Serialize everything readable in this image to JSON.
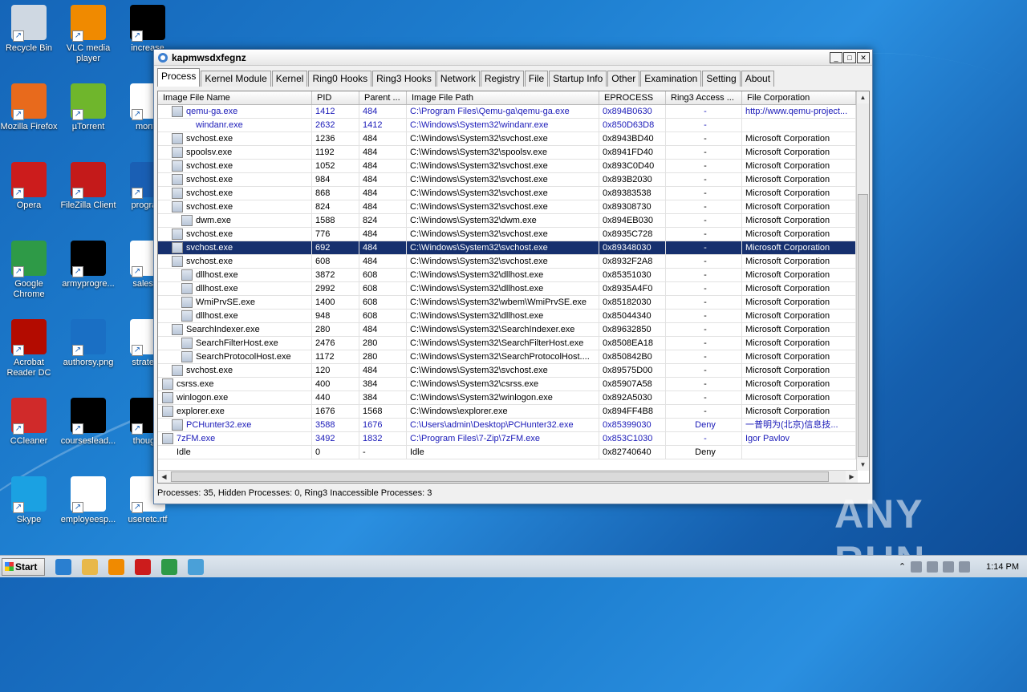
{
  "desktop": {
    "icons": [
      {
        "name": "recycle-bin",
        "label": "Recycle Bin",
        "color": "#cfd8e2"
      },
      {
        "name": "vlc",
        "label": "VLC media player",
        "color": "#f08a00"
      },
      {
        "name": "increase",
        "label": "increase",
        "color": "#000000"
      },
      {
        "name": "firefox",
        "label": "Mozilla Firefox",
        "color": "#e86a1c"
      },
      {
        "name": "utorrent",
        "label": "µTorrent",
        "color": "#6fb62c"
      },
      {
        "name": "monty",
        "label": "monty",
        "color": "#ffffff"
      },
      {
        "name": "opera",
        "label": "Opera",
        "color": "#cc1c1c"
      },
      {
        "name": "filezilla",
        "label": "FileZilla Client",
        "color": "#c41a1a"
      },
      {
        "name": "program",
        "label": "program",
        "color": "#1a5fb4"
      },
      {
        "name": "chrome",
        "label": "Google Chrome",
        "color": "#2e9a47"
      },
      {
        "name": "armyprogre",
        "label": "armyprogre...",
        "color": "#000000"
      },
      {
        "name": "salesco",
        "label": "salesco",
        "color": "#ffffff"
      },
      {
        "name": "acrobat",
        "label": "Acrobat Reader DC",
        "color": "#b30b00"
      },
      {
        "name": "authorsy",
        "label": "authorsy.png",
        "color": "#1a6fc4"
      },
      {
        "name": "strategy",
        "label": "strategy",
        "color": "#ffffff"
      },
      {
        "name": "ccleaner",
        "label": "CCleaner",
        "color": "#d02a2a"
      },
      {
        "name": "courseslead",
        "label": "courseslead...",
        "color": "#000000"
      },
      {
        "name": "thought",
        "label": "thought",
        "color": "#000000"
      },
      {
        "name": "skype",
        "label": "Skype",
        "color": "#1ba1e2"
      },
      {
        "name": "employeesp",
        "label": "employeesp...",
        "color": "#ffffff"
      },
      {
        "name": "useretc",
        "label": "useretc.rtf",
        "color": "#ffffff"
      }
    ]
  },
  "window": {
    "title": "kapmwsdxfegnz",
    "tabs": [
      "Process",
      "Kernel Module",
      "Kernel",
      "Ring0 Hooks",
      "Ring3 Hooks",
      "Network",
      "Registry",
      "File",
      "Startup Info",
      "Other",
      "Examination",
      "Setting",
      "About"
    ],
    "active_tab": "Process",
    "columns": [
      "Image File Name",
      "PID",
      "Parent ...",
      "Image File Path",
      "EPROCESS",
      "Ring3 Access ...",
      "File Corporation"
    ],
    "rows": [
      {
        "name": "qemu-ga.exe",
        "indent": 1,
        "pid": "1412",
        "ppid": "484",
        "path": "C:\\Program Files\\Qemu-ga\\qemu-ga.exe",
        "eprocess": "0x894B0630",
        "ring3": "-",
        "corp": "http://www.qemu-project...",
        "style": "blue",
        "icon": "qemu-icon"
      },
      {
        "name": "windanr.exe",
        "indent": 2,
        "pid": "2632",
        "ppid": "1412",
        "path": "C:\\Windows\\System32\\windanr.exe",
        "eprocess": "0x850D63D8",
        "ring3": "-",
        "corp": "",
        "style": "blue",
        "icon": "none"
      },
      {
        "name": "svchost.exe",
        "indent": 1,
        "pid": "1236",
        "ppid": "484",
        "path": "C:\\Windows\\System32\\svchost.exe",
        "eprocess": "0x8943BD40",
        "ring3": "-",
        "corp": "Microsoft Corporation",
        "style": "normal",
        "icon": "app-icon"
      },
      {
        "name": "spoolsv.exe",
        "indent": 1,
        "pid": "1192",
        "ppid": "484",
        "path": "C:\\Windows\\System32\\spoolsv.exe",
        "eprocess": "0x8941FD40",
        "ring3": "-",
        "corp": "Microsoft Corporation",
        "style": "normal",
        "icon": "app-icon"
      },
      {
        "name": "svchost.exe",
        "indent": 1,
        "pid": "1052",
        "ppid": "484",
        "path": "C:\\Windows\\System32\\svchost.exe",
        "eprocess": "0x893C0D40",
        "ring3": "-",
        "corp": "Microsoft Corporation",
        "style": "normal",
        "icon": "app-icon"
      },
      {
        "name": "svchost.exe",
        "indent": 1,
        "pid": "984",
        "ppid": "484",
        "path": "C:\\Windows\\System32\\svchost.exe",
        "eprocess": "0x893B2030",
        "ring3": "-",
        "corp": "Microsoft Corporation",
        "style": "normal",
        "icon": "app-icon"
      },
      {
        "name": "svchost.exe",
        "indent": 1,
        "pid": "868",
        "ppid": "484",
        "path": "C:\\Windows\\System32\\svchost.exe",
        "eprocess": "0x89383538",
        "ring3": "-",
        "corp": "Microsoft Corporation",
        "style": "normal",
        "icon": "app-icon"
      },
      {
        "name": "svchost.exe",
        "indent": 1,
        "pid": "824",
        "ppid": "484",
        "path": "C:\\Windows\\System32\\svchost.exe",
        "eprocess": "0x89308730",
        "ring3": "-",
        "corp": "Microsoft Corporation",
        "style": "normal",
        "icon": "app-icon"
      },
      {
        "name": "dwm.exe",
        "indent": 2,
        "pid": "1588",
        "ppid": "824",
        "path": "C:\\Windows\\System32\\dwm.exe",
        "eprocess": "0x894EB030",
        "ring3": "-",
        "corp": "Microsoft Corporation",
        "style": "normal",
        "icon": "app-icon"
      },
      {
        "name": "svchost.exe",
        "indent": 1,
        "pid": "776",
        "ppid": "484",
        "path": "C:\\Windows\\System32\\svchost.exe",
        "eprocess": "0x8935C728",
        "ring3": "-",
        "corp": "Microsoft Corporation",
        "style": "normal",
        "icon": "app-icon"
      },
      {
        "name": "svchost.exe",
        "indent": 1,
        "pid": "692",
        "ppid": "484",
        "path": "C:\\Windows\\System32\\svchost.exe",
        "eprocess": "0x89348030",
        "ring3": "-",
        "corp": "Microsoft Corporation",
        "style": "sel",
        "icon": "app-icon"
      },
      {
        "name": "svchost.exe",
        "indent": 1,
        "pid": "608",
        "ppid": "484",
        "path": "C:\\Windows\\System32\\svchost.exe",
        "eprocess": "0x8932F2A8",
        "ring3": "-",
        "corp": "Microsoft Corporation",
        "style": "normal",
        "icon": "app-icon"
      },
      {
        "name": "dllhost.exe",
        "indent": 2,
        "pid": "3872",
        "ppid": "608",
        "path": "C:\\Windows\\System32\\dllhost.exe",
        "eprocess": "0x85351030",
        "ring3": "-",
        "corp": "Microsoft Corporation",
        "style": "normal",
        "icon": "app-icon"
      },
      {
        "name": "dllhost.exe",
        "indent": 2,
        "pid": "2992",
        "ppid": "608",
        "path": "C:\\Windows\\System32\\dllhost.exe",
        "eprocess": "0x8935A4F0",
        "ring3": "-",
        "corp": "Microsoft Corporation",
        "style": "normal",
        "icon": "app-icon"
      },
      {
        "name": "WmiPrvSE.exe",
        "indent": 2,
        "pid": "1400",
        "ppid": "608",
        "path": "C:\\Windows\\System32\\wbem\\WmiPrvSE.exe",
        "eprocess": "0x85182030",
        "ring3": "-",
        "corp": "Microsoft Corporation",
        "style": "normal",
        "icon": "wmi-icon"
      },
      {
        "name": "dllhost.exe",
        "indent": 2,
        "pid": "948",
        "ppid": "608",
        "path": "C:\\Windows\\System32\\dllhost.exe",
        "eprocess": "0x85044340",
        "ring3": "-",
        "corp": "Microsoft Corporation",
        "style": "normal",
        "icon": "app-icon"
      },
      {
        "name": "SearchIndexer.exe",
        "indent": 1,
        "pid": "280",
        "ppid": "484",
        "path": "C:\\Windows\\System32\\SearchIndexer.exe",
        "eprocess": "0x89632850",
        "ring3": "-",
        "corp": "Microsoft Corporation",
        "style": "normal",
        "icon": "app-icon"
      },
      {
        "name": "SearchFilterHost.exe",
        "indent": 2,
        "pid": "2476",
        "ppid": "280",
        "path": "C:\\Windows\\System32\\SearchFilterHost.exe",
        "eprocess": "0x8508EA18",
        "ring3": "-",
        "corp": "Microsoft Corporation",
        "style": "normal",
        "icon": "app-icon"
      },
      {
        "name": "SearchProtocolHost.exe",
        "indent": 2,
        "pid": "1172",
        "ppid": "280",
        "path": "C:\\Windows\\System32\\SearchProtocolHost....",
        "eprocess": "0x850842B0",
        "ring3": "-",
        "corp": "Microsoft Corporation",
        "style": "normal",
        "icon": "app-icon"
      },
      {
        "name": "svchost.exe",
        "indent": 1,
        "pid": "120",
        "ppid": "484",
        "path": "C:\\Windows\\System32\\svchost.exe",
        "eprocess": "0x89575D00",
        "ring3": "-",
        "corp": "Microsoft Corporation",
        "style": "normal",
        "icon": "app-icon"
      },
      {
        "name": "csrss.exe",
        "indent": 0,
        "pid": "400",
        "ppid": "384",
        "path": "C:\\Windows\\System32\\csrss.exe",
        "eprocess": "0x85907A58",
        "ring3": "-",
        "corp": "Microsoft Corporation",
        "style": "normal",
        "icon": "app-icon"
      },
      {
        "name": "winlogon.exe",
        "indent": 0,
        "pid": "440",
        "ppid": "384",
        "path": "C:\\Windows\\System32\\winlogon.exe",
        "eprocess": "0x892A5030",
        "ring3": "-",
        "corp": "Microsoft Corporation",
        "style": "normal",
        "icon": "winlogon-icon"
      },
      {
        "name": "explorer.exe",
        "indent": 0,
        "pid": "1676",
        "ppid": "1568",
        "path": "C:\\Windows\\explorer.exe",
        "eprocess": "0x894FF4B8",
        "ring3": "-",
        "corp": "Microsoft Corporation",
        "style": "normal",
        "icon": "folder-icon"
      },
      {
        "name": "PCHunter32.exe",
        "indent": 1,
        "pid": "3588",
        "ppid": "1676",
        "path": "C:\\Users\\admin\\Desktop\\PCHunter32.exe",
        "eprocess": "0x85399030",
        "ring3": "Deny",
        "corp": "一普明为(北京)信息技...",
        "style": "blue",
        "icon": "pchunter-icon"
      },
      {
        "name": "7zFM.exe",
        "indent": 0,
        "pid": "3492",
        "ppid": "1832",
        "path": "C:\\Program Files\\7-Zip\\7zFM.exe",
        "eprocess": "0x853C1030",
        "ring3": "-",
        "corp": "Igor Pavlov",
        "style": "blue",
        "icon": "7zip-icon"
      },
      {
        "name": "Idle",
        "indent": 0,
        "pid": "0",
        "ppid": "-",
        "path": "Idle",
        "eprocess": "0x82740640",
        "ring3": "Deny",
        "corp": "",
        "style": "normal",
        "icon": "none"
      }
    ],
    "status": "Processes: 35, Hidden Processes: 0, Ring3 Inaccessible Processes: 3"
  },
  "taskbar": {
    "start_label": "Start",
    "apps": [
      {
        "name": "ie-icon",
        "color": "#2a7fd0"
      },
      {
        "name": "explorer-icon",
        "color": "#e8b84a"
      },
      {
        "name": "media-player-icon",
        "color": "#f08a00"
      },
      {
        "name": "opera-icon",
        "color": "#cc1c1c"
      },
      {
        "name": "chrome-icon",
        "color": "#2e9a47"
      },
      {
        "name": "pchunter-icon",
        "color": "#4aa0d8"
      }
    ],
    "clock": "1:14 PM"
  },
  "watermark": "ANY RUN"
}
